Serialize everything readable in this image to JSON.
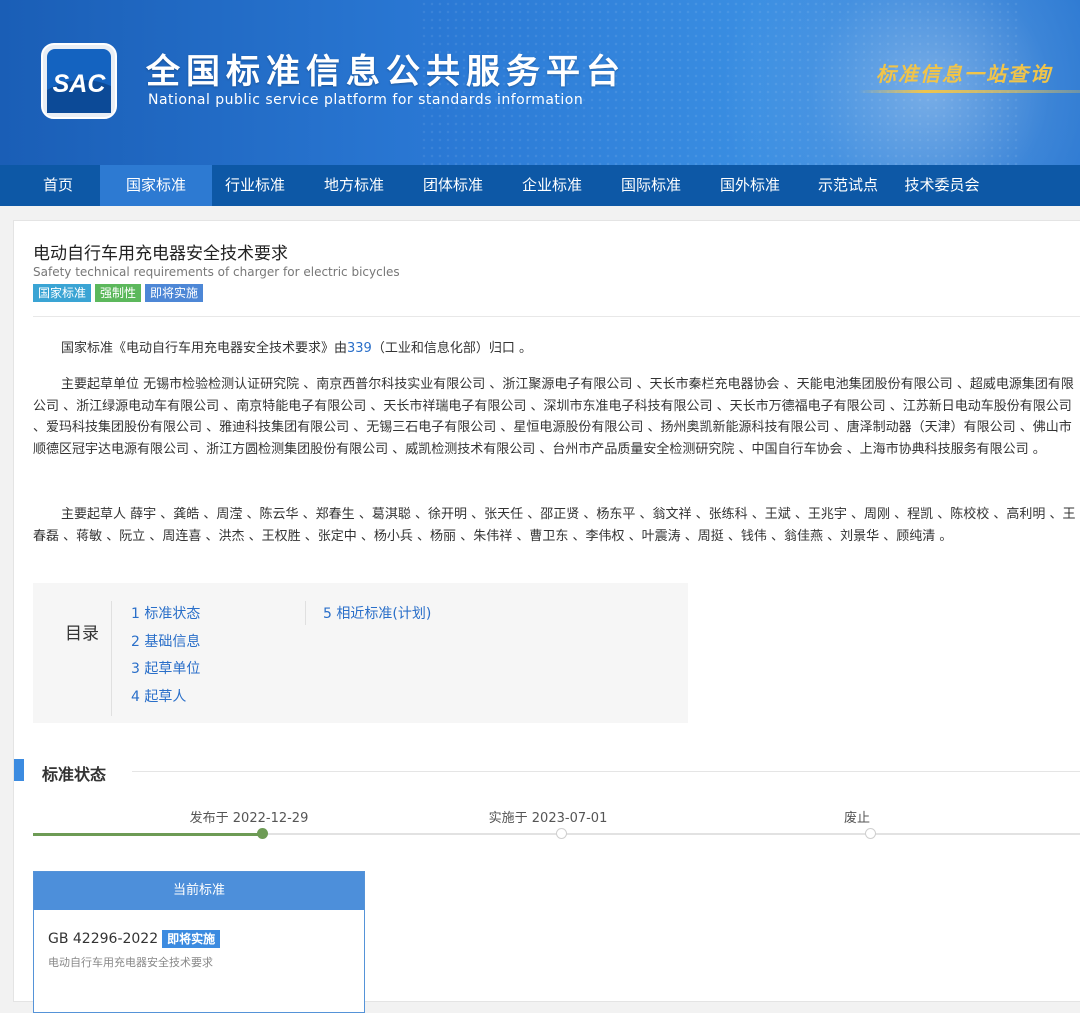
{
  "header": {
    "logo_text": "SAC",
    "title": "全国标准信息公共服务平台",
    "subtitle": "National public service platform  for standards information",
    "slogan": "标准信息一站查询"
  },
  "nav": {
    "items": [
      {
        "label": "首页",
        "active": false
      },
      {
        "label": "国家标准",
        "active": true
      },
      {
        "label": "行业标准",
        "active": false
      },
      {
        "label": "地方标准",
        "active": false
      },
      {
        "label": "团体标准",
        "active": false
      },
      {
        "label": "企业标准",
        "active": false
      },
      {
        "label": "国际标准",
        "active": false
      },
      {
        "label": "国外标准",
        "active": false
      },
      {
        "label": "示范试点",
        "active": false
      },
      {
        "label": "技术委员会",
        "active": false
      }
    ]
  },
  "standard": {
    "title": "电动自行车用充电器安全技术要求",
    "title_en": "Safety technical requirements of charger for electric bicycles",
    "tags": [
      "国家标准",
      "强制性",
      "即将实施"
    ]
  },
  "intro": {
    "prefix": "国家标准《电动自行车用充电器安全技术要求》由",
    "committee_code": "339",
    "suffix": "（工业和信息化部）归口 。"
  },
  "drafting_units": {
    "label": "主要起草单位",
    "text": "无锡市检验检测认证研究院 、南京西普尔科技实业有限公司 、浙江聚源电子有限公司 、天长市秦栏充电器协会 、天能电池集团股份有限公司 、超威电源集团有限公司 、浙江绿源电动车有限公司 、南京特能电子有限公司 、天长市祥瑞电子有限公司 、深圳市东准电子科技有限公司 、天长市万德福电子有限公司 、江苏新日电动车股份有限公司 、爱玛科技集团股份有限公司 、雅迪科技集团有限公司 、无锡三石电子有限公司 、星恒电源股份有限公司 、扬州奥凯新能源科技有限公司 、唐泽制动器（天津）有限公司 、佛山市顺德区冠宇达电源有限公司 、浙江方圆检测集团股份有限公司 、威凯检测技术有限公司 、台州市产品质量安全检测研究院 、中国自行车协会 、上海市协典科技服务有限公司 。"
  },
  "drafters": {
    "label": "主要起草人",
    "text": "薛宇 、龚皓 、周滢 、陈云华 、郑春生 、葛淇聪 、徐开明 、张天任 、邵正贤 、杨东平 、翁文祥 、张练科 、王斌 、王兆宇 、周刚 、程凯 、陈校校 、高利明 、王春磊 、蒋敏 、阮立 、周连喜 、洪杰 、王权胜 、张定中 、杨小兵 、杨丽 、朱伟祥 、曹卫东 、李伟权 、叶震涛 、周挺 、钱伟 、翁佳燕 、刘景华 、顾纯清 。"
  },
  "toc": {
    "label": "目录",
    "col1": [
      "1 标准状态",
      "2 基础信息",
      "3 起草单位",
      "4 起草人"
    ],
    "col2": [
      "5 相近标准(计划)"
    ]
  },
  "status": {
    "section_title": "标准状态",
    "timeline": [
      {
        "label": "发布于 2022-12-29",
        "done": true
      },
      {
        "label": "实施于 2023-07-01",
        "done": false
      },
      {
        "label": "废止",
        "done": false
      }
    ]
  },
  "current": {
    "header": "当前标准",
    "code": "GB 42296-2022",
    "badge": "即将实施",
    "desc": "电动自行车用充电器安全技术要求"
  },
  "colors": {
    "nav_bg": "#0d58a6",
    "nav_active": "#2d7ad2",
    "link": "#2a6fc9",
    "timeline_done": "#6d9b55"
  }
}
